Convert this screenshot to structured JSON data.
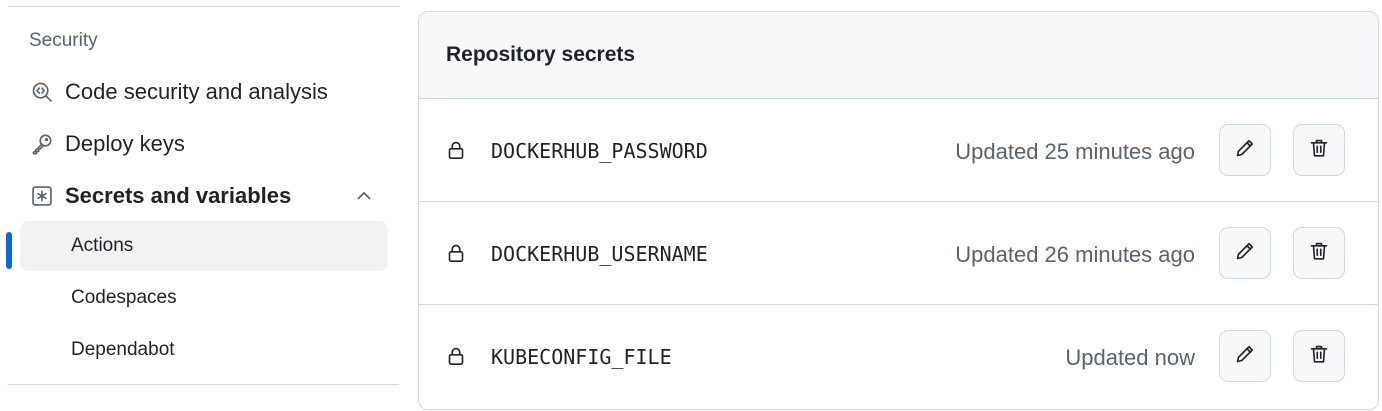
{
  "sidebar": {
    "section_heading": "Security",
    "items": [
      {
        "label": "Code security and analysis",
        "icon": "codescan-icon"
      },
      {
        "label": "Deploy keys",
        "icon": "key-icon"
      },
      {
        "label": "Secrets and variables",
        "icon": "asterisk-square-icon",
        "expanded": true
      }
    ],
    "sub_items": [
      {
        "label": "Actions",
        "active": true
      },
      {
        "label": "Codespaces",
        "active": false
      },
      {
        "label": "Dependabot",
        "active": false
      }
    ]
  },
  "panel": {
    "title": "Repository secrets",
    "secrets": [
      {
        "name": "DOCKERHUB_PASSWORD",
        "updated": "Updated 25 minutes ago"
      },
      {
        "name": "DOCKERHUB_USERNAME",
        "updated": "Updated 26 minutes ago"
      },
      {
        "name": "KUBECONFIG_FILE",
        "updated": "Updated now"
      }
    ]
  },
  "colors": {
    "accent": "#0969da",
    "text": "#1f2328",
    "muted": "#59636e",
    "border": "#d1d9e0",
    "subtle_bg": "#f6f8fa",
    "active_bg": "#f0f2f4"
  }
}
